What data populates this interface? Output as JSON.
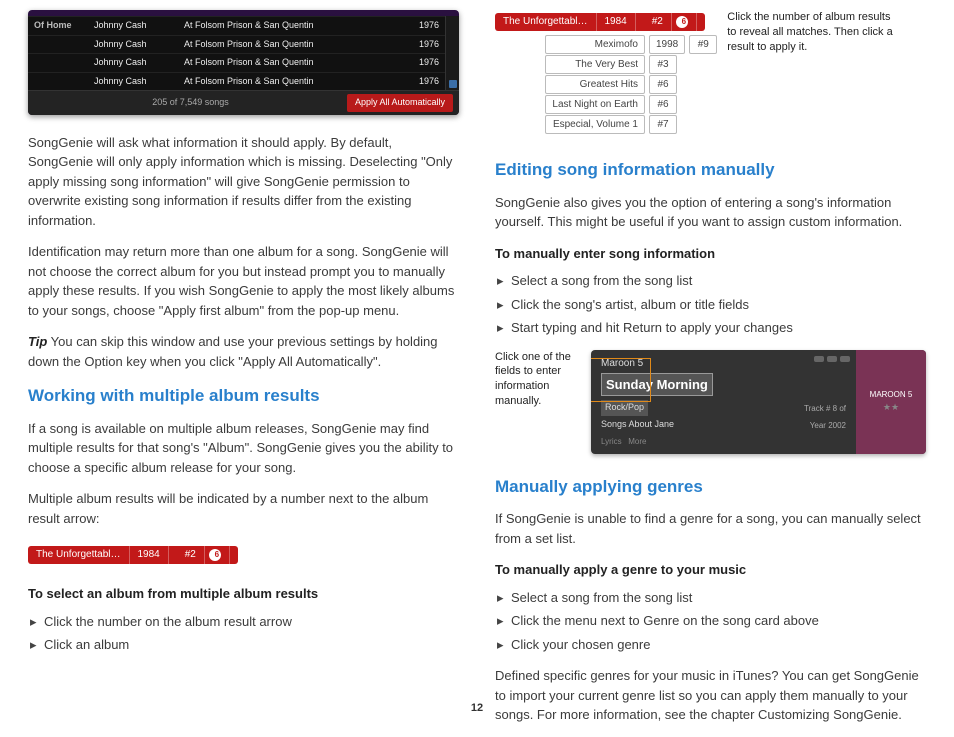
{
  "left": {
    "shot_rows": [
      {
        "c0": "Of Home",
        "artist": "Johnny Cash",
        "album": "At Folsom Prison & San Quentin",
        "yr": "1976"
      },
      {
        "c0": "",
        "artist": "Johnny Cash",
        "album": "At Folsom Prison & San Quentin",
        "yr": "1976"
      },
      {
        "c0": "",
        "artist": "Johnny Cash",
        "album": "At Folsom Prison & San Quentin",
        "yr": "1976"
      },
      {
        "c0": "",
        "artist": "Johnny Cash",
        "album": "At Folsom Prison & San Quentin",
        "yr": "1976"
      }
    ],
    "status": "205 of 7,549 songs",
    "apply_btn": "Apply All Automatically",
    "p1": "SongGenie will ask what information it should apply. By default, SongGenie will only apply information which is missing. Deselecting \"Only apply missing song information\" will give SongGenie permission to overwrite existing song information if results differ from the existing information.",
    "p2": "Identification may return more than one album for a song. SongGenie will not choose the correct album for you but instead prompt you to manually apply these results. If you wish SongGenie to apply the most likely albums to your songs, choose \"Apply first album\" from the pop-up menu.",
    "tip_label": "Tip",
    "tip": "You can skip this window and use your previous settings by holding down the Option key when you click \"Apply All Automatically\".",
    "h_working": "Working with multiple album results",
    "p3": "If a song is available on multiple album releases, SongGenie may find multiple results for that song's \"Album\". SongGenie gives you the ability to choose a specific album release for your song.",
    "p4": "Multiple album results will be indicated by a number next to the album result arrow:",
    "pill": {
      "title": "The Unforgettabl…",
      "year": "1984",
      "idx": "#2",
      "count": "6"
    },
    "h_select": "To select an album from multiple album results",
    "steps1": [
      "Click the number on the album result arrow",
      "Click an album"
    ]
  },
  "right": {
    "pill": {
      "title": "The Unforgettabl…",
      "year": "1984",
      "idx": "#2",
      "count": "6"
    },
    "drop": [
      {
        "name": "Meximofo",
        "yr": "1998",
        "n": "#9"
      },
      {
        "name": "The Very Best",
        "yr": "",
        "n": "#3"
      },
      {
        "name": "Greatest Hits",
        "yr": "",
        "n": "#6"
      },
      {
        "name": "Last Night on Earth",
        "yr": "",
        "n": "#6"
      },
      {
        "name": "Especial, Volume 1",
        "yr": "",
        "n": "#7"
      }
    ],
    "callout1": "Click the number of album results to reveal all matches. Then click a result to apply it.",
    "h_editing": "Editing song information manually",
    "p_editing": "SongGenie also gives you the option of entering a song's information yourself. This might be useful if you want to assign custom information.",
    "h_manual": "To manually enter song information",
    "steps2": [
      "Select a song from the song list",
      "Click the song's artist, album or title fields",
      "Start typing and hit Return to apply your changes"
    ],
    "callout2": "Click one of the fields to enter information manually.",
    "card": {
      "artist": "Maroon 5",
      "title": "Sunday Morning",
      "genre": "Rock/Pop",
      "album": "Songs About Jane",
      "track_lbl": "Track #",
      "track": "8",
      "of": "of",
      "year_lbl": "Year",
      "year": "2002",
      "art": "MAROON 5",
      "lyrics": "Lyrics",
      "more": "More",
      "stars": "★★"
    },
    "h_genres": "Manually applying genres",
    "p_genres": "If SongGenie is unable to find a genre for a song, you can manually select from a set list.",
    "h_genresteps": "To manually apply a genre to your music",
    "steps3": [
      "Select a song from the song list",
      "Click the menu next to Genre on the song card above",
      "Click your chosen genre"
    ],
    "p_last": "Defined specific genres for your music in iTunes? You can get SongGenie to import your current genre list so you can apply them manually to your songs. For more information, see the chapter Customizing SongGenie."
  },
  "page": "12"
}
